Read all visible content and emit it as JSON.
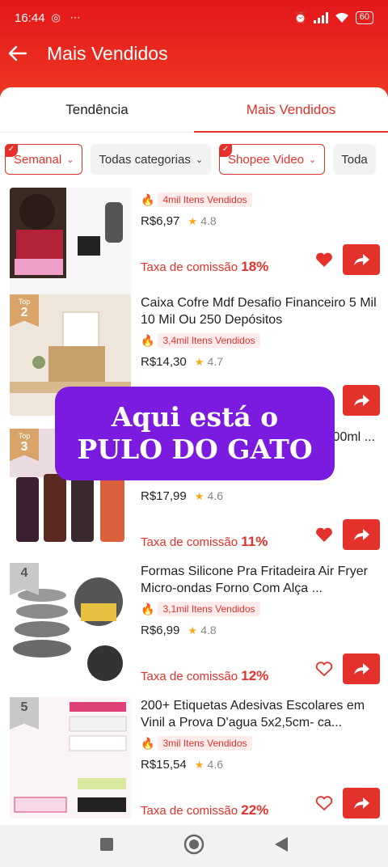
{
  "status": {
    "time": "16:44",
    "left_icons": "◎ ⋯",
    "battery": "60"
  },
  "app_bar": {
    "title": "Mais Vendidos"
  },
  "tabs": [
    {
      "label": "Tendência"
    },
    {
      "label": "Mais Vendidos"
    }
  ],
  "filters": [
    {
      "label": "Semanal"
    },
    {
      "label": "Todas categorias"
    },
    {
      "label": "Shopee Video"
    },
    {
      "label": "Toda"
    }
  ],
  "products": [
    {
      "rank": "",
      "title": "",
      "sold": "4mil Itens Vendidos",
      "price": "R$6,97",
      "rating": "4.8",
      "commission_label": "Taxa de comissão",
      "commission": "18%",
      "favorited": true
    },
    {
      "rank_top": "Top",
      "rank": "2",
      "title": "Caixa Cofre Mdf Desafio Financeiro 5 Mil 10 Mil Ou 250 Depósitos",
      "sold": "3,4mil Itens Vendidos",
      "price": "R$14,30",
      "rating": "4.7",
      "commission_label": "",
      "commission": "",
      "favorited": false
    },
    {
      "rank_top": "Top",
      "rank": "3",
      "title": "s 00ml ...",
      "sold": "",
      "price": "R$17,99",
      "rating": "4.6",
      "commission_label": "Taxa de comissão",
      "commission": "11%",
      "favorited": true
    },
    {
      "rank": "4",
      "title": "Formas Silicone Pra Fritadeira Air Fryer Micro-ondas Forno Com Alça ...",
      "sold": "3,1mil Itens Vendidos",
      "price": "R$6,99",
      "rating": "4.8",
      "commission_label": "Taxa de comissão",
      "commission": "12%",
      "favorited": false
    },
    {
      "rank": "5",
      "title": "200+  Etiquetas Adesivas Escolares em Vinil a Prova D'agua 5x2,5cm- ca...",
      "sold": "3mil Itens Vendidos",
      "price": "R$15,54",
      "rating": "4.6",
      "commission_label": "Taxa de comissão",
      "commission": "22%",
      "favorited": false
    }
  ],
  "overlay": {
    "line1": "Aqui está o",
    "line2": "PULO DO GATO"
  },
  "colors": {
    "brand": "#e4312b",
    "overlay": "#7a1bdf"
  }
}
